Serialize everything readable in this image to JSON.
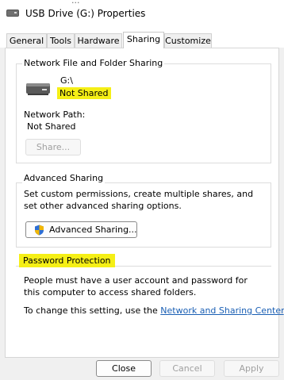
{
  "window": {
    "title": "USB Drive (G:) Properties",
    "background_text": "..."
  },
  "tabs": [
    {
      "label": "General",
      "active": false
    },
    {
      "label": "Tools",
      "active": false
    },
    {
      "label": "Hardware",
      "active": false
    },
    {
      "label": "Sharing",
      "active": true
    },
    {
      "label": "Customize",
      "active": false
    }
  ],
  "network_sharing": {
    "group_label": "Network File and Folder Sharing",
    "drive_path": "G:\\",
    "drive_status": "Not Shared",
    "network_path_label": "Network Path:",
    "network_path_value": "Not Shared",
    "share_button": "Share..."
  },
  "advanced_sharing": {
    "group_label": "Advanced Sharing",
    "description": "Set custom permissions, create multiple shares, and set other advanced sharing options.",
    "button": "Advanced Sharing..."
  },
  "password_protection": {
    "label": "Password Protection",
    "description": "People must have a user account and password for this computer to access shared folders.",
    "change_text": "To change this setting, use the",
    "link": "Network and Sharing Center",
    "period": "."
  },
  "footer": {
    "close": "Close",
    "cancel": "Cancel",
    "apply": "Apply"
  },
  "colors": {
    "highlight": "#f5ef16",
    "link": "#1a5fb4"
  }
}
